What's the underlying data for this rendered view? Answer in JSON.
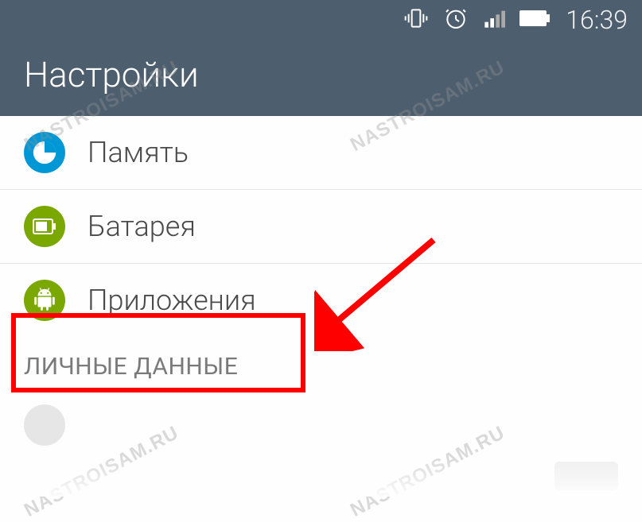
{
  "status": {
    "time": "16:39"
  },
  "header": {
    "title": "Настройки"
  },
  "items": {
    "memory": {
      "label": "Память"
    },
    "battery": {
      "label": "Батарея"
    },
    "apps": {
      "label": "Приложения"
    }
  },
  "section": {
    "personal": "ЛИЧНЫЕ ДАННЫЕ"
  },
  "watermark": "NASTROISAM.RU"
}
